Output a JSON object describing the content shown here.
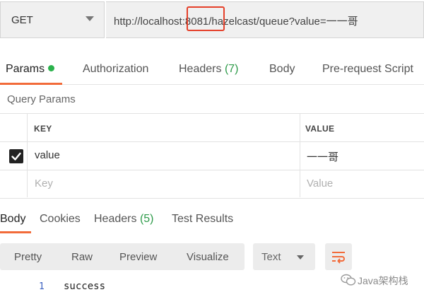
{
  "request": {
    "method": "GET",
    "url": "http://localhost:8081/hazelcast/queue?value=一一哥"
  },
  "tabs": [
    {
      "label": "Params",
      "active": true
    },
    {
      "label": "Authorization"
    },
    {
      "label": "Headers",
      "count": "(7)"
    },
    {
      "label": "Body"
    },
    {
      "label": "Pre-request Script"
    }
  ],
  "query_params": {
    "title": "Query Params",
    "headers": {
      "key": "KEY",
      "value": "VALUE"
    },
    "rows": [
      {
        "key": "value",
        "value": "一一哥",
        "checked": true
      }
    ],
    "placeholders": {
      "key": "Key",
      "value": "Value"
    }
  },
  "response_tabs": [
    {
      "label": "Body",
      "active": true
    },
    {
      "label": "Cookies"
    },
    {
      "label": "Headers",
      "count": "(5)"
    },
    {
      "label": "Test Results"
    }
  ],
  "view_modes": [
    "Pretty",
    "Raw",
    "Preview",
    "Visualize"
  ],
  "format": "Text",
  "response_body": [
    {
      "line": "1",
      "text": "success"
    }
  ],
  "watermark": "Java架构栈",
  "colors": {
    "accent": "#f26b3a",
    "count_green": "#2e9b4a",
    "highlight_box": "#e5402a"
  }
}
